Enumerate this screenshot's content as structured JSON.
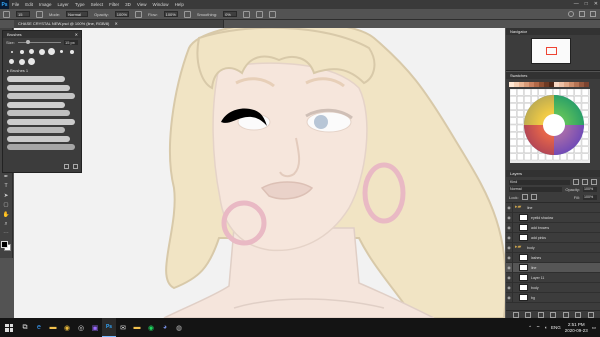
{
  "app": {
    "logo": "Ps",
    "brand_color": "#31a8ff"
  },
  "menu": [
    "File",
    "Edit",
    "Image",
    "Layer",
    "Type",
    "Select",
    "Filter",
    "3D",
    "View",
    "Window",
    "Help"
  ],
  "window_controls": {
    "minimize": "—",
    "maximize": "□",
    "close": "✕"
  },
  "options_bar": {
    "size": "15",
    "mode_label": "Mode:",
    "mode_value": "Normal",
    "opacity_label": "Opacity:",
    "opacity_value": "100%",
    "flow_label": "Flow:",
    "flow_value": "100%",
    "smoothing_label": "Smoothing:",
    "smoothing_value": "0%"
  },
  "document_tab": {
    "title": "CHASE CRYSTAL NEW.psd @ 100% (line, RGB/8)",
    "close": "✕"
  },
  "tools": [
    {
      "name": "move-tool-icon",
      "glyph": "✥"
    },
    {
      "name": "marquee-tool-icon",
      "glyph": "⬚"
    },
    {
      "name": "lasso-tool-icon",
      "glyph": "ℓ"
    },
    {
      "name": "quick-select-icon",
      "glyph": "⌖"
    },
    {
      "name": "crop-tool-icon",
      "glyph": "⊹"
    },
    {
      "name": "frame-tool-icon",
      "glyph": "⊠"
    },
    {
      "name": "eyedropper-icon",
      "glyph": "⟋"
    },
    {
      "name": "healing-brush-icon",
      "glyph": "⊕"
    },
    {
      "name": "brush-tool-icon",
      "glyph": "✎"
    },
    {
      "name": "clone-stamp-icon",
      "glyph": "⊥"
    },
    {
      "name": "history-brush-icon",
      "glyph": "↺"
    },
    {
      "name": "eraser-tool-icon",
      "glyph": "▭"
    },
    {
      "name": "gradient-tool-icon",
      "glyph": "▤"
    },
    {
      "name": "blur-tool-icon",
      "glyph": "◆"
    },
    {
      "name": "dodge-tool-icon",
      "glyph": "●"
    },
    {
      "name": "pen-tool-icon",
      "glyph": "✒"
    },
    {
      "name": "type-tool-icon",
      "glyph": "T"
    },
    {
      "name": "path-select-icon",
      "glyph": "➤"
    },
    {
      "name": "shape-tool-icon",
      "glyph": "▢"
    },
    {
      "name": "hand-tool-icon",
      "glyph": "✋"
    },
    {
      "name": "zoom-tool-icon",
      "glyph": "⌕"
    },
    {
      "name": "more-tools-icon",
      "glyph": "⋯"
    }
  ],
  "active_tool": "brush-tool-icon",
  "brushes_panel": {
    "title": "Brushes",
    "close": "✕",
    "size_label": "Size:",
    "size_value": "15 px",
    "size_level": 0.18,
    "folder_label": "▸ Brushes 1",
    "preset_sizes": [
      2,
      4,
      5,
      6,
      7,
      3,
      4,
      5,
      6,
      7
    ],
    "stroke_colors": [
      "#e9e9e9",
      "#e4e4e4",
      "#dcdcdc",
      "#e9e9e9",
      "#d8d8d8",
      "#e5e5e5",
      "#cfcfcf",
      "#e2e2e2",
      "#b8b8b8"
    ]
  },
  "navigator_title": "Navigator",
  "swatches_title": "Swatches",
  "swatch_colors": [
    "#ffe8d4",
    "#f5d0b4",
    "#eab796",
    "#d99c79",
    "#c8805f",
    "#b16847",
    "#8f4f32",
    "#6d3a24",
    "#4e2818",
    "#f7d7c3",
    "#edc1a6",
    "#e0a887",
    "#cc8d6b",
    "#b57353",
    "#96583e",
    "#7a4330"
  ],
  "layers_panel": {
    "title": "Layers",
    "kind_label": "Kind",
    "blend_mode": "Normal",
    "opacity_label": "Opacity:",
    "opacity_value": "100%",
    "lock_label": "Lock:",
    "fill_label": "Fill:",
    "fill_value": "100%",
    "rows": [
      {
        "name": "line",
        "folder": true,
        "selected": false
      },
      {
        "name": "eyelid shadow",
        "folder": false,
        "selected": false
      },
      {
        "name": "add browns",
        "folder": false,
        "selected": false
      },
      {
        "name": "add pinks",
        "folder": false,
        "selected": false
      },
      {
        "name": "body",
        "folder": true,
        "selected": false
      },
      {
        "name": "lashes",
        "folder": false,
        "selected": false
      },
      {
        "name": "line",
        "folder": false,
        "selected": true
      },
      {
        "name": "Layer 11",
        "folder": false,
        "selected": false
      },
      {
        "name": "body",
        "folder": false,
        "selected": false
      },
      {
        "name": "bg",
        "folder": false,
        "selected": false
      }
    ]
  },
  "taskbar": {
    "apps": [
      {
        "name": "task-view-icon",
        "glyph": "⧉",
        "color": "#dddddd"
      },
      {
        "name": "edge-icon",
        "glyph": "e",
        "color": "#3aa0ff"
      },
      {
        "name": "file-explorer-icon",
        "glyph": "▬",
        "color": "#f2c14e"
      },
      {
        "name": "chrome-icon",
        "glyph": "◉",
        "color": "#e9b93a"
      },
      {
        "name": "obs-icon",
        "glyph": "◎",
        "color": "#dddddd"
      },
      {
        "name": "twitch-icon",
        "glyph": "▣",
        "color": "#9b6bff"
      },
      {
        "name": "photoshop-taskbar-icon",
        "glyph": "Ps",
        "color": "#31a8ff"
      },
      {
        "name": "mail-icon",
        "glyph": "✉",
        "color": "#dddddd"
      },
      {
        "name": "folder-icon",
        "glyph": "▬",
        "color": "#f2c14e"
      },
      {
        "name": "spotify-icon",
        "glyph": "◉",
        "color": "#1ed760"
      },
      {
        "name": "discord-icon",
        "glyph": "◕",
        "color": "#7289da"
      },
      {
        "name": "steam-icon",
        "glyph": "◍",
        "color": "#bbbbbb"
      }
    ],
    "active_app": "photoshop-taskbar-icon",
    "time": "2:51 PM",
    "date": "2020-09-23",
    "lang": "ENG"
  }
}
